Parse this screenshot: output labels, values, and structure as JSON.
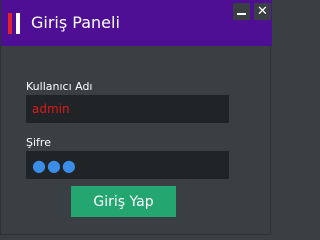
{
  "window": {
    "title": "Giriş Paneli",
    "minimize_symbol": "_",
    "close_symbol": "✕",
    "colors": {
      "titlebar": "#4f0f94",
      "background": "#3a3f44",
      "accent": "#23a66f"
    }
  },
  "form": {
    "username_label": "Kullanıcı Adı",
    "username_value": "admin",
    "password_label": "Şifre",
    "password_display": "●●●",
    "login_label": "Giriş Yap"
  },
  "icons": {
    "logo": "app-logo-icon",
    "minimize": "minimize-icon",
    "close": "close-icon"
  }
}
